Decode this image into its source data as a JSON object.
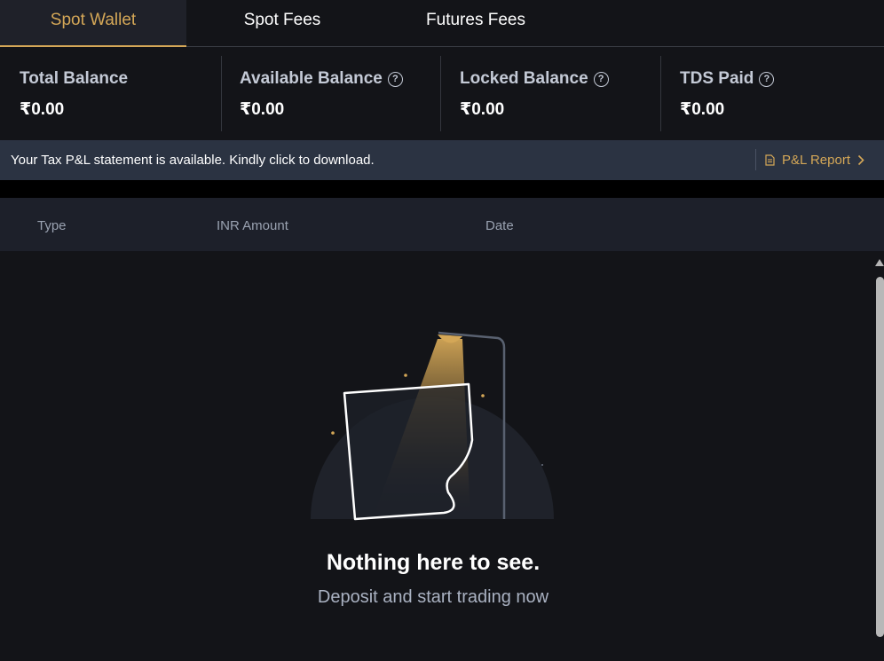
{
  "tabs": [
    {
      "label": "Spot Wallet",
      "active": true
    },
    {
      "label": "Spot Fees",
      "active": false
    },
    {
      "label": "Futures Fees",
      "active": false
    }
  ],
  "balances": [
    {
      "label": "Total Balance",
      "value": "₹0.00",
      "help": false
    },
    {
      "label": "Available Balance",
      "value": "₹0.00",
      "help": true
    },
    {
      "label": "Locked Balance",
      "value": "₹0.00",
      "help": true
    },
    {
      "label": "TDS Paid",
      "value": "₹0.00",
      "help": true
    }
  ],
  "banner": {
    "text": "Your Tax P&L statement is available. Kindly click to download.",
    "button_label": "P&L Report"
  },
  "table": {
    "columns": [
      "Type",
      "INR Amount",
      "Date"
    ]
  },
  "empty_state": {
    "title": "Nothing here to see.",
    "subtitle": "Deposit and start trading now"
  },
  "icons": {
    "help": "question-circle-icon",
    "report": "document-icon",
    "chevron": "chevron-right-icon"
  },
  "colors": {
    "accent": "#d4a757",
    "background": "#131418",
    "banner": "#2b3342",
    "table_header": "#1d202a"
  }
}
